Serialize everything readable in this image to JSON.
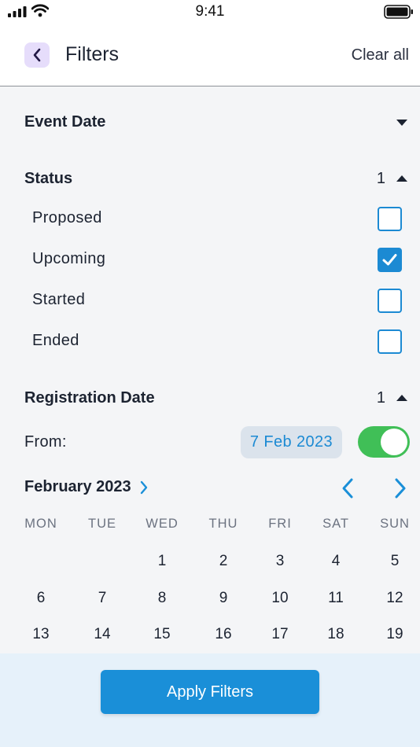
{
  "status_bar": {
    "time": "9:41"
  },
  "header": {
    "title": "Filters",
    "clear_all": "Clear all"
  },
  "event_date": {
    "title": "Event Date"
  },
  "status": {
    "title": "Status",
    "count": "1",
    "options": [
      {
        "label": "Proposed",
        "checked": false
      },
      {
        "label": "Upcoming",
        "checked": true
      },
      {
        "label": "Started",
        "checked": false
      },
      {
        "label": "Ended",
        "checked": false
      }
    ]
  },
  "registration_date": {
    "title": "Registration Date",
    "count": "1",
    "from_label": "From:",
    "from_value": "7 Feb 2023",
    "enabled": true
  },
  "calendar": {
    "month": "February 2023",
    "weekdays": [
      "MON",
      "TUE",
      "WED",
      "THU",
      "FRI",
      "SAT",
      "SUN"
    ],
    "weeks": [
      [
        "",
        "",
        "1",
        "2",
        "3",
        "4",
        "5"
      ],
      [
        "6",
        "7",
        "8",
        "9",
        "10",
        "11",
        "12"
      ],
      [
        "13",
        "14",
        "15",
        "16",
        "17",
        "18",
        "19"
      ]
    ]
  },
  "footer": {
    "apply_label": "Apply Filters"
  },
  "colors": {
    "accent": "#1a8fd8",
    "toggle_on": "#40bf57",
    "back_bg": "#e6ddfb"
  }
}
